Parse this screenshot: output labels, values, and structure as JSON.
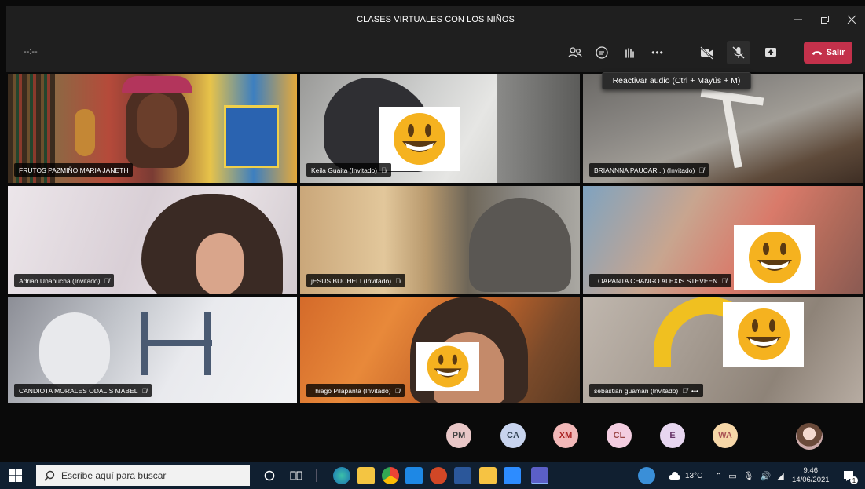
{
  "window": {
    "title": "CLASES VIRTUALES CON LOS NIÑOS"
  },
  "toolbar": {
    "timer": "--:--",
    "more": "•••",
    "leave_label": "Salir",
    "mic_tooltip": "Reactivar audio (Ctrl + Mayús + M)"
  },
  "participants": [
    {
      "name": "FRUTOS PAZMIÑO MARIA JANETH"
    },
    {
      "name": "Keila Guaita (Invitado)"
    },
    {
      "name": "BRIANNNA PAUCAR , ) (Invitado)"
    },
    {
      "name": "Adrian Unapucha (Invitado)"
    },
    {
      "name": "jESUS BUCHELI (Invitado)"
    },
    {
      "name": "TOAPANTA CHANGO ALEXIS STEVEEN"
    },
    {
      "name": "CANDIOTA MORALES ODALIS MABEL"
    },
    {
      "name": "Thiago Pilapanta (Invitado)"
    },
    {
      "name": "sebastian guaman (Invitado)",
      "extra": "•••"
    }
  ],
  "avatars": [
    {
      "initials": "PM",
      "color": "#e9c7c7",
      "text": "#444"
    },
    {
      "initials": "CA",
      "color": "#c8d4ee",
      "text": "#345"
    },
    {
      "initials": "XM",
      "color": "#f2b8b8",
      "text": "#a22"
    },
    {
      "initials": "CL",
      "color": "#f3cde0",
      "text": "#944"
    },
    {
      "initials": "E",
      "color": "#e7d6f0",
      "text": "#636"
    },
    {
      "initials": "WA",
      "color": "#f6d7a8",
      "text": "#a55"
    }
  ],
  "taskbar": {
    "search_placeholder": "Escribe aquí para buscar",
    "weather": "13°C",
    "time": "9:46",
    "date": "14/06/2021",
    "notifications": "1"
  }
}
